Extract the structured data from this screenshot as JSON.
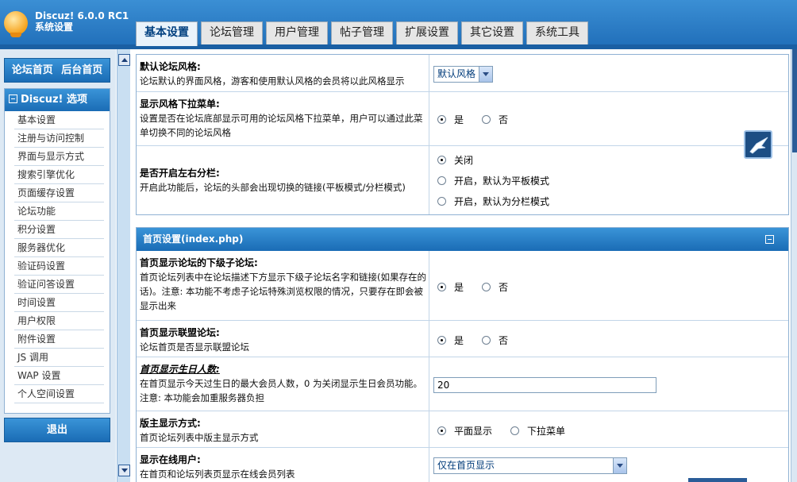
{
  "header": {
    "app_title": "Discuz! 6.0.0 RC1",
    "app_subtitle": "系统设置",
    "tabs": [
      {
        "label": "基本设置",
        "active": true
      },
      {
        "label": "论坛管理",
        "active": false
      },
      {
        "label": "用户管理",
        "active": false
      },
      {
        "label": "帖子管理",
        "active": false
      },
      {
        "label": "扩展设置",
        "active": false
      },
      {
        "label": "其它设置",
        "active": false
      },
      {
        "label": "系统工具",
        "active": false
      }
    ]
  },
  "sidebar": {
    "home_links": [
      "论坛首页",
      "后台首页"
    ],
    "menu_title": "Discuz! 选项",
    "items": [
      "基本设置",
      "注册与访问控制",
      "界面与显示方式",
      "搜索引擎优化",
      "页面缓存设置",
      "论坛功能",
      "积分设置",
      "服务器优化",
      "验证码设置",
      "验证问答设置",
      "时间设置",
      "用户权限",
      "附件设置",
      "JS 调用",
      "WAP 设置",
      "个人空间设置"
    ],
    "logout": "退出"
  },
  "panel1": {
    "rows": [
      {
        "title": "默认论坛风格:",
        "desc": "论坛默认的界面风格，游客和使用默认风格的会员将以此风格显示",
        "select_value": "默认风格"
      },
      {
        "title": "显示风格下拉菜单:",
        "desc": "设置是否在论坛底部显示可用的论坛风格下拉菜单，用户可以通过此菜单切换不同的论坛风格",
        "options": [
          "是",
          "否"
        ],
        "selected": 0
      },
      {
        "title": "是否开启左右分栏:",
        "desc": "开启此功能后，论坛的头部会出现切换的链接(平板模式/分栏模式)",
        "options": [
          "关闭",
          "开启，默认为平板模式",
          "开启，默认为分栏模式"
        ],
        "selected": 0
      }
    ]
  },
  "panel2": {
    "title": "首页设置(index.php)",
    "rows": [
      {
        "title": "首页显示论坛的下级子论坛:",
        "desc": "首页论坛列表中在论坛描述下方显示下级子论坛名字和链接(如果存在的话)。注意: 本功能不考虑子论坛特殊浏览权限的情况，只要存在即会被显示出来",
        "options": [
          "是",
          "否"
        ],
        "selected": 0
      },
      {
        "title": "首页显示联盟论坛:",
        "desc": "论坛首页是否显示联盟论坛",
        "options": [
          "是",
          "否"
        ],
        "selected": 0
      },
      {
        "title": "首页显示生日人数:",
        "desc": "在首页显示今天过生日的最大会员人数，0 为关闭显示生日会员功能。注意: 本功能会加重服务器负担",
        "input_value": "20"
      },
      {
        "title": "版主显示方式:",
        "desc": "首页论坛列表中版主显示方式",
        "options": [
          "平面显示",
          "下拉菜单"
        ],
        "selected": 0
      },
      {
        "title": "显示在线用户:",
        "desc": "在首页和论坛列表页显示在线会员列表",
        "select_value": "仅在首页显示"
      }
    ]
  },
  "colors": {
    "header_blue": "#2a7cc4",
    "panel_head_blue": "#1a6cb5",
    "sidebar_bg": "#dde9f4"
  }
}
